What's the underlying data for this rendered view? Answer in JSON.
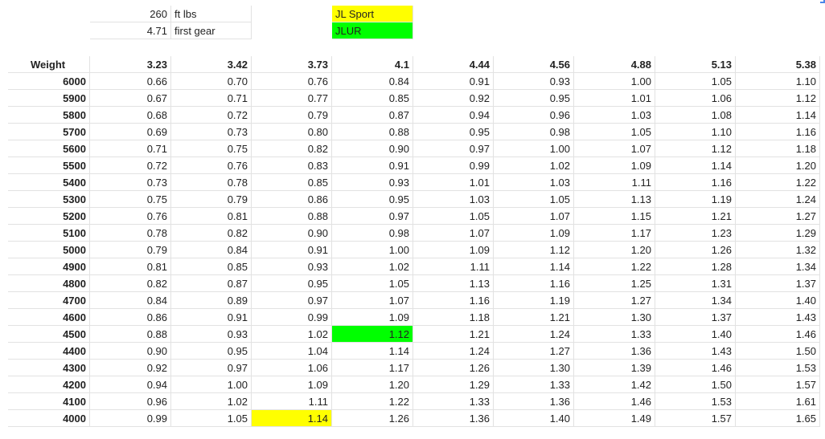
{
  "info": {
    "torque_value": "260",
    "torque_label": "ft lbs",
    "first_gear_value": "4.71",
    "first_gear_label": "first gear",
    "legend": [
      {
        "label": "JL Sport",
        "color": "#ffff00"
      },
      {
        "label": "JLUR",
        "color": "#00ff00"
      }
    ]
  },
  "table": {
    "weight_header": "Weight",
    "ratios": [
      "3.23",
      "3.42",
      "3.73",
      "4.1",
      "4.44",
      "4.56",
      "4.88",
      "5.13",
      "5.38"
    ],
    "rows": [
      {
        "weight": "6000",
        "values": [
          "0.66",
          "0.70",
          "0.76",
          "0.84",
          "0.91",
          "0.93",
          "1.00",
          "1.05",
          "1.10"
        ]
      },
      {
        "weight": "5900",
        "values": [
          "0.67",
          "0.71",
          "0.77",
          "0.85",
          "0.92",
          "0.95",
          "1.01",
          "1.06",
          "1.12"
        ]
      },
      {
        "weight": "5800",
        "values": [
          "0.68",
          "0.72",
          "0.79",
          "0.87",
          "0.94",
          "0.96",
          "1.03",
          "1.08",
          "1.14"
        ]
      },
      {
        "weight": "5700",
        "values": [
          "0.69",
          "0.73",
          "0.80",
          "0.88",
          "0.95",
          "0.98",
          "1.05",
          "1.10",
          "1.16"
        ]
      },
      {
        "weight": "5600",
        "values": [
          "0.71",
          "0.75",
          "0.82",
          "0.90",
          "0.97",
          "1.00",
          "1.07",
          "1.12",
          "1.18"
        ]
      },
      {
        "weight": "5500",
        "values": [
          "0.72",
          "0.76",
          "0.83",
          "0.91",
          "0.99",
          "1.02",
          "1.09",
          "1.14",
          "1.20"
        ]
      },
      {
        "weight": "5400",
        "values": [
          "0.73",
          "0.78",
          "0.85",
          "0.93",
          "1.01",
          "1.03",
          "1.11",
          "1.16",
          "1.22"
        ]
      },
      {
        "weight": "5300",
        "values": [
          "0.75",
          "0.79",
          "0.86",
          "0.95",
          "1.03",
          "1.05",
          "1.13",
          "1.19",
          "1.24"
        ]
      },
      {
        "weight": "5200",
        "values": [
          "0.76",
          "0.81",
          "0.88",
          "0.97",
          "1.05",
          "1.07",
          "1.15",
          "1.21",
          "1.27"
        ]
      },
      {
        "weight": "5100",
        "values": [
          "0.78",
          "0.82",
          "0.90",
          "0.98",
          "1.07",
          "1.09",
          "1.17",
          "1.23",
          "1.29"
        ]
      },
      {
        "weight": "5000",
        "values": [
          "0.79",
          "0.84",
          "0.91",
          "1.00",
          "1.09",
          "1.12",
          "1.20",
          "1.26",
          "1.32"
        ]
      },
      {
        "weight": "4900",
        "values": [
          "0.81",
          "0.85",
          "0.93",
          "1.02",
          "1.11",
          "1.14",
          "1.22",
          "1.28",
          "1.34"
        ]
      },
      {
        "weight": "4800",
        "values": [
          "0.82",
          "0.87",
          "0.95",
          "1.05",
          "1.13",
          "1.16",
          "1.25",
          "1.31",
          "1.37"
        ]
      },
      {
        "weight": "4700",
        "values": [
          "0.84",
          "0.89",
          "0.97",
          "1.07",
          "1.16",
          "1.19",
          "1.27",
          "1.34",
          "1.40"
        ]
      },
      {
        "weight": "4600",
        "values": [
          "0.86",
          "0.91",
          "0.99",
          "1.09",
          "1.18",
          "1.21",
          "1.30",
          "1.37",
          "1.43"
        ]
      },
      {
        "weight": "4500",
        "values": [
          "0.88",
          "0.93",
          "1.02",
          "1.12",
          "1.21",
          "1.24",
          "1.33",
          "1.40",
          "1.46"
        ],
        "highlight": {
          "col": 3,
          "color": "#00ff00"
        }
      },
      {
        "weight": "4400",
        "values": [
          "0.90",
          "0.95",
          "1.04",
          "1.14",
          "1.24",
          "1.27",
          "1.36",
          "1.43",
          "1.50"
        ]
      },
      {
        "weight": "4300",
        "values": [
          "0.92",
          "0.97",
          "1.06",
          "1.17",
          "1.26",
          "1.30",
          "1.39",
          "1.46",
          "1.53"
        ]
      },
      {
        "weight": "4200",
        "values": [
          "0.94",
          "1.00",
          "1.09",
          "1.20",
          "1.29",
          "1.33",
          "1.42",
          "1.50",
          "1.57"
        ]
      },
      {
        "weight": "4100",
        "values": [
          "0.96",
          "1.02",
          "1.11",
          "1.22",
          "1.33",
          "1.36",
          "1.46",
          "1.53",
          "1.61"
        ]
      },
      {
        "weight": "4000",
        "values": [
          "0.99",
          "1.05",
          "1.14",
          "1.26",
          "1.36",
          "1.40",
          "1.49",
          "1.57",
          "1.65"
        ],
        "highlight": {
          "col": 2,
          "color": "#ffff00"
        }
      }
    ]
  }
}
